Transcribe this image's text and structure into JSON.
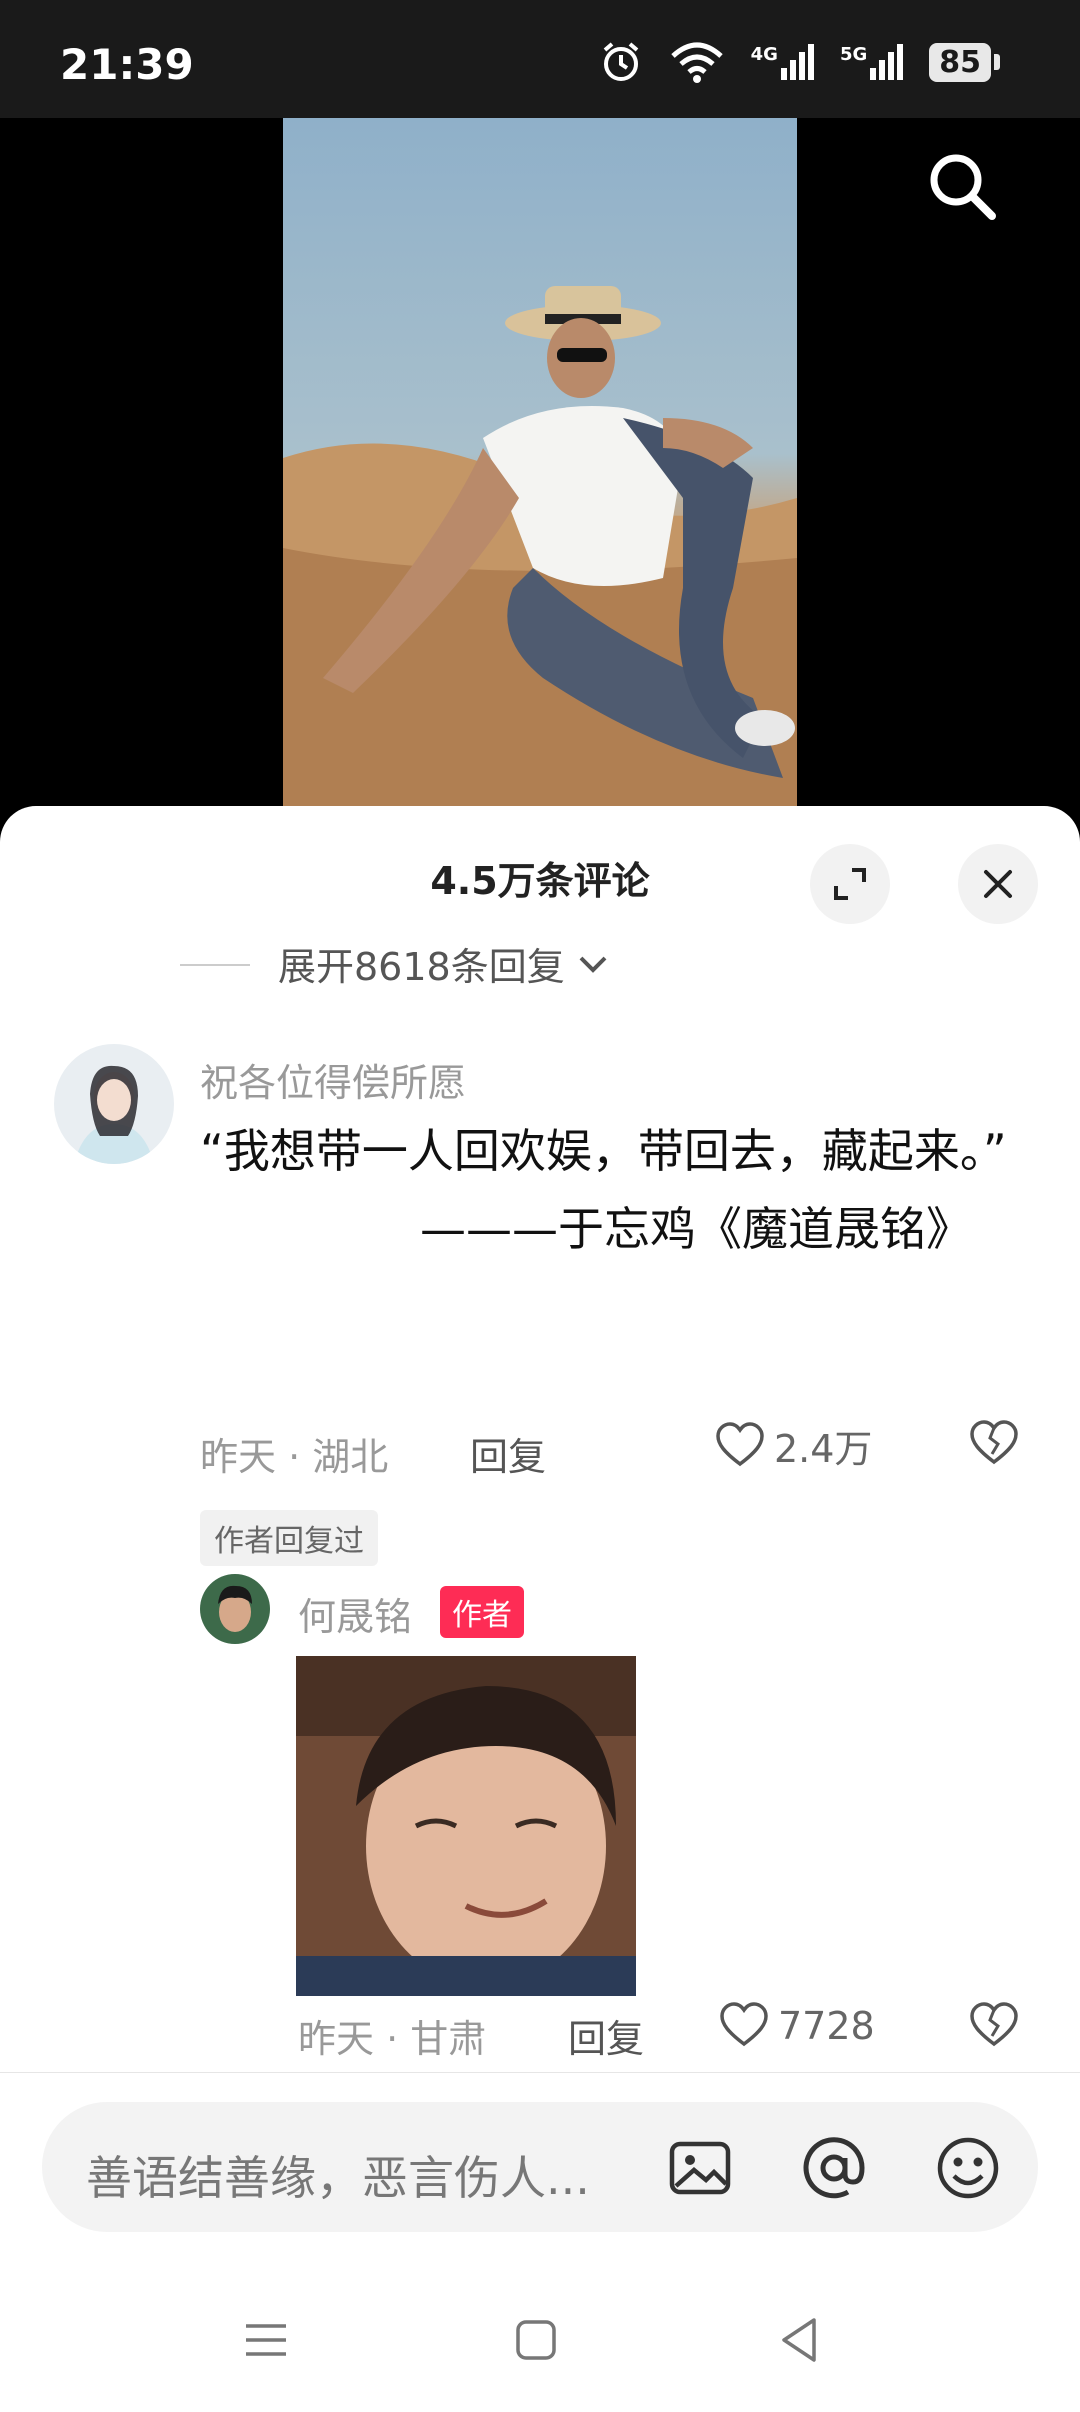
{
  "status_bar": {
    "time": "21:39",
    "battery": "85",
    "network_1": "4G",
    "network_2": "5G"
  },
  "comments_panel": {
    "title": "4.5万条评论",
    "expand_replies": "展开8618条回复",
    "comment": {
      "username": "祝各位得偿所愿",
      "text_line1": "“我想带一人回欢娱，带回去，藏起来。”",
      "text_line2": "———于忘鸡《魔道晟铭》",
      "date_location": "昨天 · 湖北",
      "reply_label": "回复",
      "like_count": "2.4万",
      "author_replied_tag": "作者回复过"
    },
    "reply": {
      "username": "何晟铭",
      "author_badge": "作者",
      "date_location": "昨天 · 甘肃",
      "reply_label": "回复",
      "like_count": "7728"
    }
  },
  "input_bar": {
    "placeholder": "善语结善缘，恶言伤人..."
  },
  "icons": {
    "search": "search-icon",
    "expand": "expand-icon",
    "close": "close-icon",
    "like": "heart-icon",
    "dislike": "broken-heart-icon",
    "image": "image-icon",
    "mention": "at-icon",
    "emoji": "emoji-icon"
  },
  "colors": {
    "author_badge": "#fe2c55",
    "sheet_bg": "#ffffff",
    "status_bar_bg": "#1a1a1a"
  }
}
